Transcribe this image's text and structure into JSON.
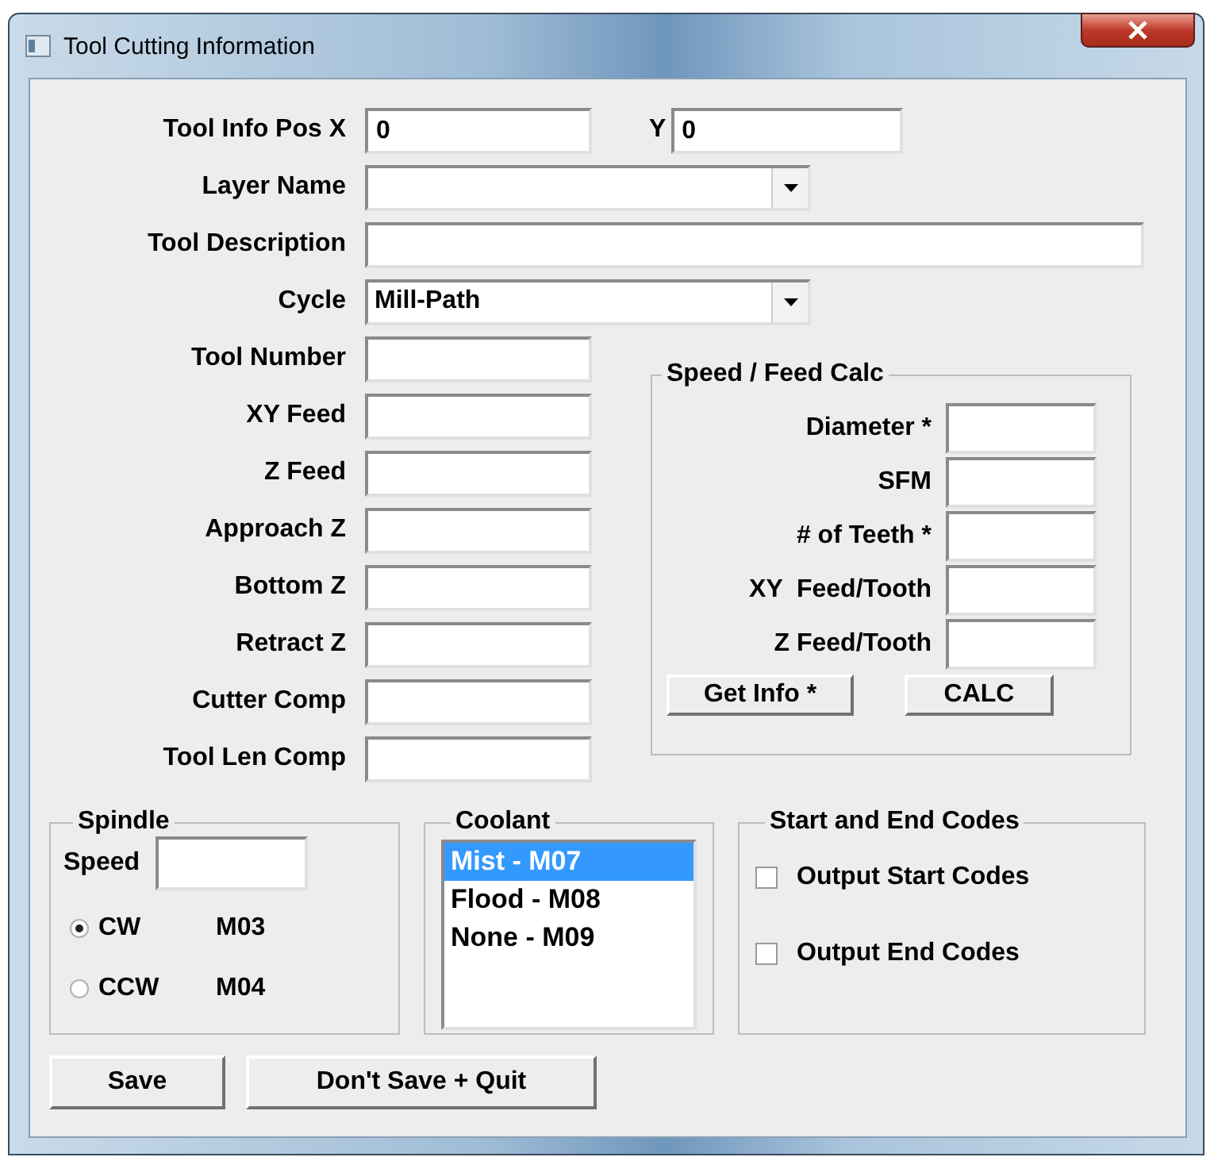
{
  "window": {
    "title": "Tool Cutting Information"
  },
  "position": {
    "x_label": "Tool Info Pos X",
    "x_value": "0",
    "y_label": "Y",
    "y_value": "0"
  },
  "layer_name": {
    "label": "Layer Name"
  },
  "tool_description": {
    "label": "Tool Description"
  },
  "cycle": {
    "label": "Cycle",
    "value": "Mill-Path"
  },
  "tool_fields": [
    {
      "label": "Tool Number"
    },
    {
      "label": "XY Feed"
    },
    {
      "label": "Z Feed"
    },
    {
      "label": "Approach Z"
    },
    {
      "label": "Bottom Z"
    },
    {
      "label": "Retract Z"
    },
    {
      "label": "Cutter Comp"
    },
    {
      "label": "Tool Len Comp"
    }
  ],
  "speed_feed": {
    "title": "Speed / Feed Calc",
    "fields": [
      {
        "label": "Diameter *"
      },
      {
        "label": "SFM"
      },
      {
        "label": "# of Teeth *"
      },
      {
        "label": "XY  Feed/Tooth"
      },
      {
        "label": "Z Feed/Tooth"
      }
    ],
    "buttons": [
      "Get Info *",
      "CALC"
    ]
  },
  "spindle": {
    "title": "Spindle",
    "speed_label": "Speed",
    "directions": [
      {
        "label": "CW",
        "code": "M03",
        "selected": true
      },
      {
        "label": "CCW",
        "code": "M04",
        "selected": false
      }
    ]
  },
  "coolant": {
    "title": "Coolant",
    "options": [
      {
        "label": "Mist - M07",
        "selected": true
      },
      {
        "label": "Flood - M08",
        "selected": false
      },
      {
        "label": "None - M09",
        "selected": false
      }
    ]
  },
  "codes": {
    "title": "Start and End Codes",
    "options": [
      {
        "label": "Output Start Codes",
        "checked": false
      },
      {
        "label": "Output End Codes",
        "checked": false
      }
    ]
  },
  "buttons": [
    "Save",
    "Don't Save + Quit"
  ]
}
